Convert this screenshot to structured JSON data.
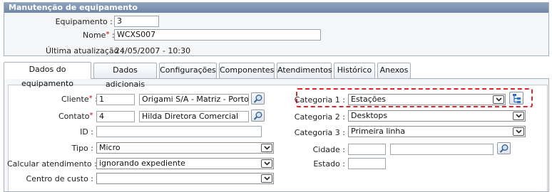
{
  "panel": {
    "title": "Manutenção de equipamento",
    "equipamento_label": "Equipamento :",
    "equipamento_value": "3",
    "nome_label": "Nome",
    "nome_colon": ":",
    "nome_value": "WCXS007",
    "atualizacao_label": "Última atualização :",
    "atualizacao_value": "24/05/2007 - 10:30"
  },
  "tabs": [
    {
      "label": "Dados do equipamento",
      "active": true
    },
    {
      "label": "Dados adicionais"
    },
    {
      "label": "Configurações"
    },
    {
      "label": "Componentes"
    },
    {
      "label": "Atendimentos"
    },
    {
      "label": "Histórico"
    },
    {
      "label": "Anexos"
    }
  ],
  "form": {
    "cliente_label": "Cliente",
    "cliente_code": "1",
    "cliente_name": "Origami S/A - Matriz - Porto Aleg",
    "contato_label": "Contato",
    "contato_code": "4",
    "contato_name": "Hilda Diretora Comercial",
    "id_label": "ID :",
    "id_value": "",
    "tipo_label": "Tipo :",
    "tipo_value": "Micro",
    "calcular_label": "Calcular atendimento :",
    "calcular_value": "ignorando expediente",
    "centro_label": "Centro de custo :",
    "centro_value": "",
    "categoria1_label": "Categoria 1 :",
    "categoria1_value": "Estações",
    "categoria2_label": "Categoria 2 :",
    "categoria2_value": "Desktops",
    "categoria3_label": "Categoria 3 :",
    "categoria3_value": "Primeira linha",
    "cidade_label": "Cidade :",
    "cidade_uf": "",
    "cidade_name": "",
    "estado_label": "Estado :",
    "estado_value": "",
    "colon": ":",
    "required_mark": "*"
  },
  "colors": {
    "panel_header": "#7a90ad",
    "highlight": "#e0222a",
    "required": "#d40000"
  }
}
